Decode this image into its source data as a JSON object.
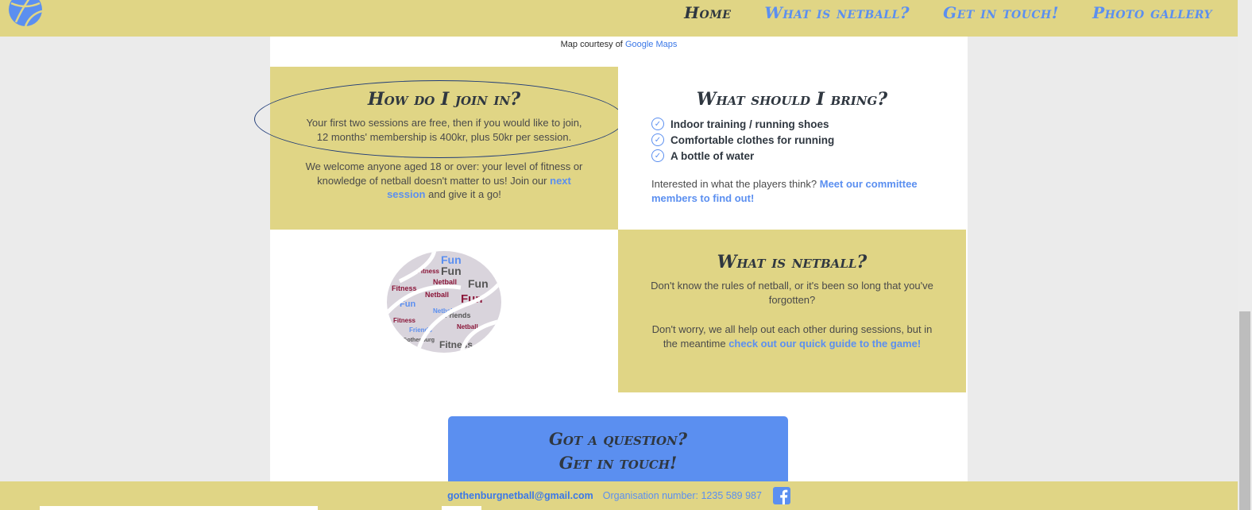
{
  "nav": {
    "logo_icon": "netball-icon",
    "links": [
      {
        "label": "Home",
        "active": true
      },
      {
        "label": "What is netball?",
        "active": false
      },
      {
        "label": "Get in touch!",
        "active": false
      },
      {
        "label": "Photo gallery",
        "active": false
      }
    ]
  },
  "map_credit": {
    "prefix": "Map courtesy of",
    "link": "Google Maps"
  },
  "join": {
    "title": "How do I join in?",
    "para1": "Your first two sessions are free, then if you would like to join, 12 months' membership is 400kr, plus 50kr per session.",
    "para2_start": "We welcome anyone aged 18 or over: your level of fitness or knowledge of netball doesn't matter to us! Join our",
    "para2_link": "next session",
    "para2_end": "and give it a go!"
  },
  "bring": {
    "title": "What should I bring?",
    "items": [
      "Indoor training / running shoes",
      "Comfortable clothes for running",
      "A bottle of water"
    ],
    "interest_text": "Interested in what the players think?",
    "interest_link": "Meet our committee members to find out!"
  },
  "what": {
    "title": "What is netball?",
    "para1": "Don't know the rules of netball, or it's been so long that you've forgotten?",
    "para2_start": "Don't worry, we all help out each other during sessions, but in the meantime",
    "para2_link": "check out our quick guide to the game!"
  },
  "word_cloud_words": [
    "Fun",
    "Fitness",
    "Netball",
    "Friends",
    "Gothenburg"
  ],
  "cta": {
    "line1": "Got a question?",
    "line2": "Get in touch!"
  },
  "footer": {
    "email": "gothenburgnetball@gmail.com",
    "org": "Organisation number: 1235 589 987",
    "social_icon": "facebook-icon"
  },
  "colors": {
    "accent_yellow": "#e0d585",
    "accent_blue": "#5b8ff0",
    "heading": "#2f3740"
  }
}
